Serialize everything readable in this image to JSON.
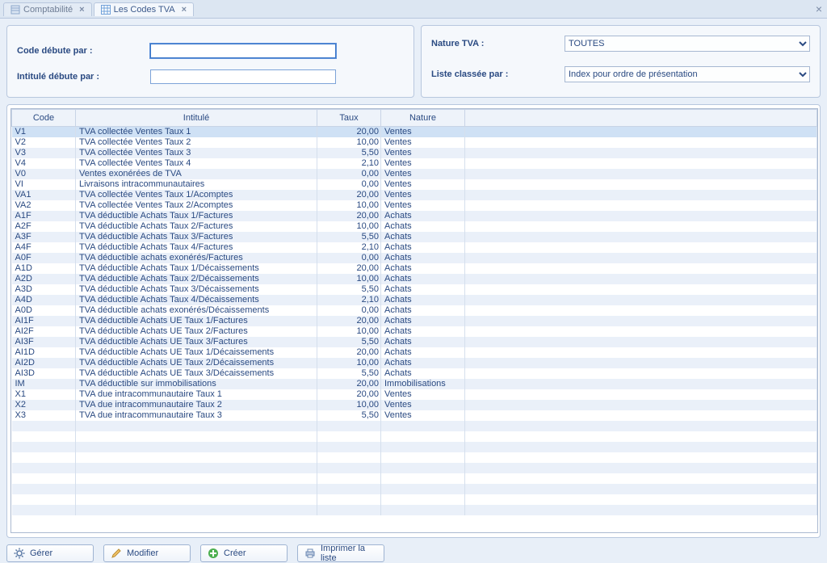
{
  "tabs": [
    {
      "label": "Comptabilité"
    },
    {
      "label": "Les Codes TVA"
    }
  ],
  "filters_left": {
    "code_label": "Code débute par :",
    "code_value": "",
    "intitule_label": "Intitulé débute par :",
    "intitule_value": ""
  },
  "filters_right": {
    "nature_label": "Nature TVA :",
    "nature_value": "TOUTES",
    "liste_label": "Liste classée par :",
    "liste_value": "Index pour ordre de présentation"
  },
  "columns": {
    "code": "Code",
    "intitule": "Intitulé",
    "taux": "Taux",
    "nature": "Nature"
  },
  "rows": [
    {
      "code": "V1",
      "intitule": "TVA collectée Ventes Taux 1",
      "taux": "20,00",
      "nature": "Ventes"
    },
    {
      "code": "V2",
      "intitule": "TVA collectée Ventes Taux 2",
      "taux": "10,00",
      "nature": "Ventes"
    },
    {
      "code": "V3",
      "intitule": "TVA collectée Ventes Taux 3",
      "taux": "5,50",
      "nature": "Ventes"
    },
    {
      "code": "V4",
      "intitule": "TVA collectée Ventes Taux 4",
      "taux": "2,10",
      "nature": "Ventes"
    },
    {
      "code": "V0",
      "intitule": "Ventes exonérées de TVA",
      "taux": "0,00",
      "nature": "Ventes"
    },
    {
      "code": "VI",
      "intitule": "Livraisons intracommunautaires",
      "taux": "0,00",
      "nature": "Ventes"
    },
    {
      "code": "VA1",
      "intitule": "TVA collectée Ventes Taux 1/Acomptes",
      "taux": "20,00",
      "nature": "Ventes"
    },
    {
      "code": "VA2",
      "intitule": "TVA collectée Ventes Taux 2/Acomptes",
      "taux": "10,00",
      "nature": "Ventes"
    },
    {
      "code": "A1F",
      "intitule": "TVA déductible Achats Taux 1/Factures",
      "taux": "20,00",
      "nature": "Achats"
    },
    {
      "code": "A2F",
      "intitule": "TVA déductible Achats Taux 2/Factures",
      "taux": "10,00",
      "nature": "Achats"
    },
    {
      "code": "A3F",
      "intitule": "TVA déductible Achats Taux 3/Factures",
      "taux": "5,50",
      "nature": "Achats"
    },
    {
      "code": "A4F",
      "intitule": "TVA déductible Achats Taux 4/Factures",
      "taux": "2,10",
      "nature": "Achats"
    },
    {
      "code": "A0F",
      "intitule": "TVA déductible achats exonérés/Factures",
      "taux": "0,00",
      "nature": "Achats"
    },
    {
      "code": "A1D",
      "intitule": "TVA déductible Achats Taux 1/Décaissements",
      "taux": "20,00",
      "nature": "Achats"
    },
    {
      "code": "A2D",
      "intitule": "TVA déductible Achats Taux 2/Décaissements",
      "taux": "10,00",
      "nature": "Achats"
    },
    {
      "code": "A3D",
      "intitule": "TVA déductible Achats Taux 3/Décaissements",
      "taux": "5,50",
      "nature": "Achats"
    },
    {
      "code": "A4D",
      "intitule": "TVA déductible Achats Taux 4/Décaissements",
      "taux": "2,10",
      "nature": "Achats"
    },
    {
      "code": "A0D",
      "intitule": "TVA déductible achats exonérés/Décaissements",
      "taux": "0,00",
      "nature": "Achats"
    },
    {
      "code": "AI1F",
      "intitule": "TVA déductible Achats UE Taux 1/Factures",
      "taux": "20,00",
      "nature": "Achats"
    },
    {
      "code": "AI2F",
      "intitule": "TVA déductible Achats UE Taux 2/Factures",
      "taux": "10,00",
      "nature": "Achats"
    },
    {
      "code": "AI3F",
      "intitule": "TVA déductible Achats UE Taux 3/Factures",
      "taux": "5,50",
      "nature": "Achats"
    },
    {
      "code": "AI1D",
      "intitule": "TVA déductible Achats UE Taux 1/Décaissements",
      "taux": "20,00",
      "nature": "Achats"
    },
    {
      "code": "AI2D",
      "intitule": "TVA déductible Achats UE Taux 2/Décaissements",
      "taux": "10,00",
      "nature": "Achats"
    },
    {
      "code": "AI3D",
      "intitule": "TVA déductible Achats UE Taux 3/Décaissements",
      "taux": "5,50",
      "nature": "Achats"
    },
    {
      "code": "IM",
      "intitule": "TVA déductible sur immobilisations",
      "taux": "20,00",
      "nature": "Immobilisations"
    },
    {
      "code": "X1",
      "intitule": "TVA due intracommunautaire Taux 1",
      "taux": "20,00",
      "nature": "Ventes"
    },
    {
      "code": "X2",
      "intitule": "TVA due intracommunautaire Taux 2",
      "taux": "10,00",
      "nature": "Ventes"
    },
    {
      "code": "X3",
      "intitule": "TVA due intracommunautaire Taux 3",
      "taux": "5,50",
      "nature": "Ventes"
    }
  ],
  "buttons": {
    "gerer": "Gérer",
    "modifier": "Modifier",
    "creer": "Créer",
    "imprimer": "Imprimer la liste"
  }
}
